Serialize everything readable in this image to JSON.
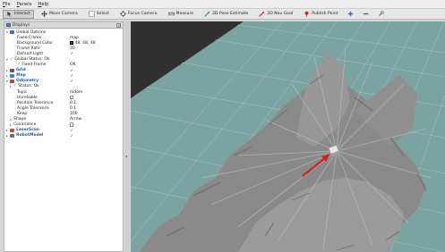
{
  "menubar": {
    "items": [
      "File",
      "Panels",
      "Help"
    ]
  },
  "toolbar": {
    "tools": [
      {
        "label": "Interact",
        "icon": "interact-icon",
        "active": true
      },
      {
        "label": "Move Camera",
        "icon": "move-camera-icon"
      },
      {
        "label": "Select",
        "icon": "select-icon"
      },
      {
        "label": "Focus Camera",
        "icon": "focus-camera-icon"
      },
      {
        "label": "Measure",
        "icon": "measure-icon"
      },
      {
        "label": "2D Pose Estimate",
        "icon": "pose-estimate-icon"
      },
      {
        "label": "2D Nav Goal",
        "icon": "nav-goal-icon"
      },
      {
        "label": "Publish Point",
        "icon": "publish-point-icon"
      }
    ]
  },
  "displays": {
    "title": "Displays",
    "rows": [
      {
        "label": "Global Options",
        "indent": 0,
        "arrow": "▾",
        "icon": "globe",
        "value": ""
      },
      {
        "label": "Fixed Frame",
        "indent": 2,
        "value": "map"
      },
      {
        "label": "Background Color",
        "indent": 2,
        "value": "48; 48; 48",
        "swatch": true
      },
      {
        "label": "Frame Rate",
        "indent": 2,
        "value": "30"
      },
      {
        "label": "Default Light",
        "indent": 2,
        "value": "✓",
        "check": true
      },
      {
        "label": "Global Status: Ok",
        "indent": 0,
        "arrow": "▾",
        "ok": true,
        "value": ""
      },
      {
        "label": "Fixed Frame",
        "indent": 2,
        "ok": true,
        "value": "OK"
      },
      {
        "label": "Grid",
        "indent": 0,
        "arrow": "▸",
        "icon": "grid",
        "blue": true,
        "value": "✓",
        "check": true
      },
      {
        "label": "Map",
        "indent": 0,
        "arrow": "▸",
        "icon": "map",
        "blue": true,
        "value": "✓",
        "check": true
      },
      {
        "label": "Odometry",
        "indent": 0,
        "arrow": "▾",
        "icon": "odom",
        "blue": true,
        "value": "✓",
        "check": true
      },
      {
        "label": "Status: Ok",
        "indent": 1,
        "arrow": "▸",
        "ok": true,
        "value": ""
      },
      {
        "label": "Topic",
        "indent": 2,
        "value": "/odom"
      },
      {
        "label": "Unreliable",
        "indent": 2,
        "value": "",
        "emptycheck": true
      },
      {
        "label": "Position Tolerance",
        "indent": 2,
        "value": "0.1"
      },
      {
        "label": "Angle Tolerance",
        "indent": 2,
        "value": "0.1"
      },
      {
        "label": "Keep",
        "indent": 2,
        "value": "100"
      },
      {
        "label": "Shape",
        "indent": 1,
        "arrow": "▸",
        "value": "Arrow"
      },
      {
        "label": "Covariance",
        "indent": 1,
        "arrow": "▸",
        "value": "",
        "emptycheck": true
      },
      {
        "label": "LaserScan",
        "indent": 0,
        "arrow": "▸",
        "icon": "laser",
        "blue": true,
        "value": "✓",
        "check": true
      },
      {
        "label": "RobotModel",
        "indent": 0,
        "arrow": "▸",
        "icon": "robot",
        "blue": true,
        "value": "✓",
        "check": true
      }
    ]
  },
  "colors": {
    "background": "#303030",
    "floor": "#7fa6a3",
    "map_gray": "#8c8c8c",
    "grid": "#9a9a9a",
    "odometry_arrow": "#e02020"
  }
}
